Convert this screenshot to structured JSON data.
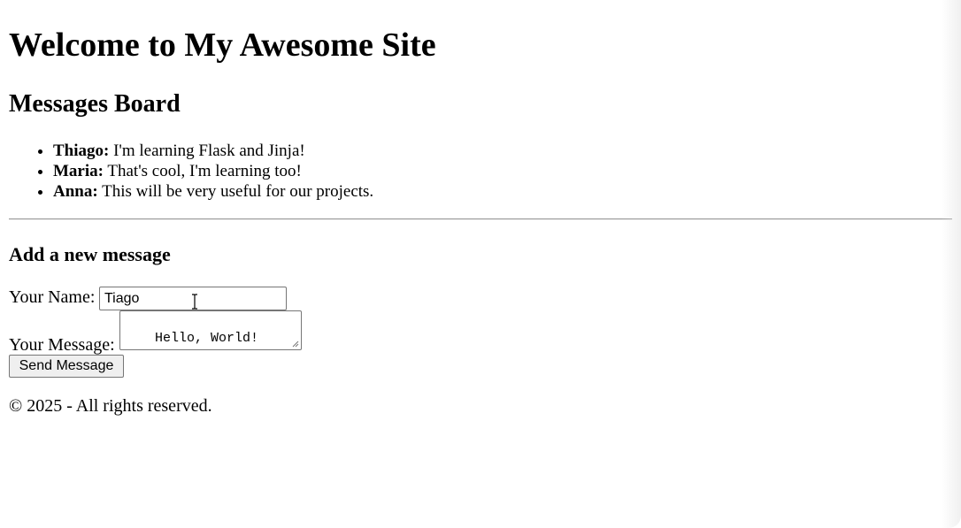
{
  "header": {
    "title": "Welcome to My Awesome Site"
  },
  "board": {
    "title": "Messages Board",
    "messages": [
      {
        "author": "Thiago:",
        "text": " I'm learning Flask and Jinja!"
      },
      {
        "author": "Maria:",
        "text": " That's cool, I'm learning too!"
      },
      {
        "author": "Anna:",
        "text": " This will be very useful for our projects."
      }
    ]
  },
  "form": {
    "title": "Add a new message",
    "name_label": "Your Name:",
    "name_value": "Tiago",
    "message_label": "Your Message:",
    "message_value": "Hello, World!",
    "submit_label": "Send Message"
  },
  "footer": {
    "text": "© 2025 - All rights reserved."
  },
  "icons": {
    "cursor": "text-cursor-icon",
    "resize": "resize-handle-icon"
  }
}
